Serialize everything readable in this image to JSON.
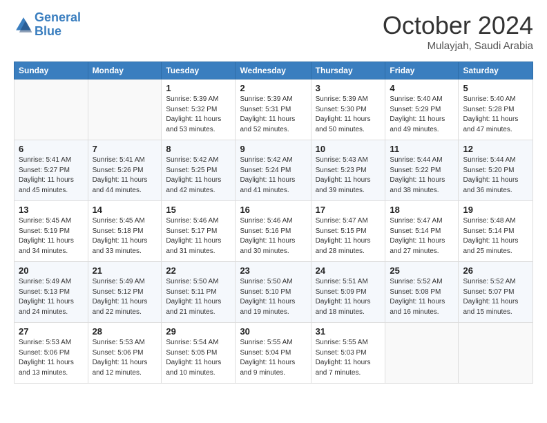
{
  "header": {
    "logo_line1": "General",
    "logo_line2": "Blue",
    "month": "October 2024",
    "location": "Mulayjah, Saudi Arabia"
  },
  "weekdays": [
    "Sunday",
    "Monday",
    "Tuesday",
    "Wednesday",
    "Thursday",
    "Friday",
    "Saturday"
  ],
  "weeks": [
    [
      {
        "day": "",
        "info": ""
      },
      {
        "day": "",
        "info": ""
      },
      {
        "day": "1",
        "info": "Sunrise: 5:39 AM\nSunset: 5:32 PM\nDaylight: 11 hours and 53 minutes."
      },
      {
        "day": "2",
        "info": "Sunrise: 5:39 AM\nSunset: 5:31 PM\nDaylight: 11 hours and 52 minutes."
      },
      {
        "day": "3",
        "info": "Sunrise: 5:39 AM\nSunset: 5:30 PM\nDaylight: 11 hours and 50 minutes."
      },
      {
        "day": "4",
        "info": "Sunrise: 5:40 AM\nSunset: 5:29 PM\nDaylight: 11 hours and 49 minutes."
      },
      {
        "day": "5",
        "info": "Sunrise: 5:40 AM\nSunset: 5:28 PM\nDaylight: 11 hours and 47 minutes."
      }
    ],
    [
      {
        "day": "6",
        "info": "Sunrise: 5:41 AM\nSunset: 5:27 PM\nDaylight: 11 hours and 45 minutes."
      },
      {
        "day": "7",
        "info": "Sunrise: 5:41 AM\nSunset: 5:26 PM\nDaylight: 11 hours and 44 minutes."
      },
      {
        "day": "8",
        "info": "Sunrise: 5:42 AM\nSunset: 5:25 PM\nDaylight: 11 hours and 42 minutes."
      },
      {
        "day": "9",
        "info": "Sunrise: 5:42 AM\nSunset: 5:24 PM\nDaylight: 11 hours and 41 minutes."
      },
      {
        "day": "10",
        "info": "Sunrise: 5:43 AM\nSunset: 5:23 PM\nDaylight: 11 hours and 39 minutes."
      },
      {
        "day": "11",
        "info": "Sunrise: 5:44 AM\nSunset: 5:22 PM\nDaylight: 11 hours and 38 minutes."
      },
      {
        "day": "12",
        "info": "Sunrise: 5:44 AM\nSunset: 5:20 PM\nDaylight: 11 hours and 36 minutes."
      }
    ],
    [
      {
        "day": "13",
        "info": "Sunrise: 5:45 AM\nSunset: 5:19 PM\nDaylight: 11 hours and 34 minutes."
      },
      {
        "day": "14",
        "info": "Sunrise: 5:45 AM\nSunset: 5:18 PM\nDaylight: 11 hours and 33 minutes."
      },
      {
        "day": "15",
        "info": "Sunrise: 5:46 AM\nSunset: 5:17 PM\nDaylight: 11 hours and 31 minutes."
      },
      {
        "day": "16",
        "info": "Sunrise: 5:46 AM\nSunset: 5:16 PM\nDaylight: 11 hours and 30 minutes."
      },
      {
        "day": "17",
        "info": "Sunrise: 5:47 AM\nSunset: 5:15 PM\nDaylight: 11 hours and 28 minutes."
      },
      {
        "day": "18",
        "info": "Sunrise: 5:47 AM\nSunset: 5:14 PM\nDaylight: 11 hours and 27 minutes."
      },
      {
        "day": "19",
        "info": "Sunrise: 5:48 AM\nSunset: 5:14 PM\nDaylight: 11 hours and 25 minutes."
      }
    ],
    [
      {
        "day": "20",
        "info": "Sunrise: 5:49 AM\nSunset: 5:13 PM\nDaylight: 11 hours and 24 minutes."
      },
      {
        "day": "21",
        "info": "Sunrise: 5:49 AM\nSunset: 5:12 PM\nDaylight: 11 hours and 22 minutes."
      },
      {
        "day": "22",
        "info": "Sunrise: 5:50 AM\nSunset: 5:11 PM\nDaylight: 11 hours and 21 minutes."
      },
      {
        "day": "23",
        "info": "Sunrise: 5:50 AM\nSunset: 5:10 PM\nDaylight: 11 hours and 19 minutes."
      },
      {
        "day": "24",
        "info": "Sunrise: 5:51 AM\nSunset: 5:09 PM\nDaylight: 11 hours and 18 minutes."
      },
      {
        "day": "25",
        "info": "Sunrise: 5:52 AM\nSunset: 5:08 PM\nDaylight: 11 hours and 16 minutes."
      },
      {
        "day": "26",
        "info": "Sunrise: 5:52 AM\nSunset: 5:07 PM\nDaylight: 11 hours and 15 minutes."
      }
    ],
    [
      {
        "day": "27",
        "info": "Sunrise: 5:53 AM\nSunset: 5:06 PM\nDaylight: 11 hours and 13 minutes."
      },
      {
        "day": "28",
        "info": "Sunrise: 5:53 AM\nSunset: 5:06 PM\nDaylight: 11 hours and 12 minutes."
      },
      {
        "day": "29",
        "info": "Sunrise: 5:54 AM\nSunset: 5:05 PM\nDaylight: 11 hours and 10 minutes."
      },
      {
        "day": "30",
        "info": "Sunrise: 5:55 AM\nSunset: 5:04 PM\nDaylight: 11 hours and 9 minutes."
      },
      {
        "day": "31",
        "info": "Sunrise: 5:55 AM\nSunset: 5:03 PM\nDaylight: 11 hours and 7 minutes."
      },
      {
        "day": "",
        "info": ""
      },
      {
        "day": "",
        "info": ""
      }
    ]
  ]
}
